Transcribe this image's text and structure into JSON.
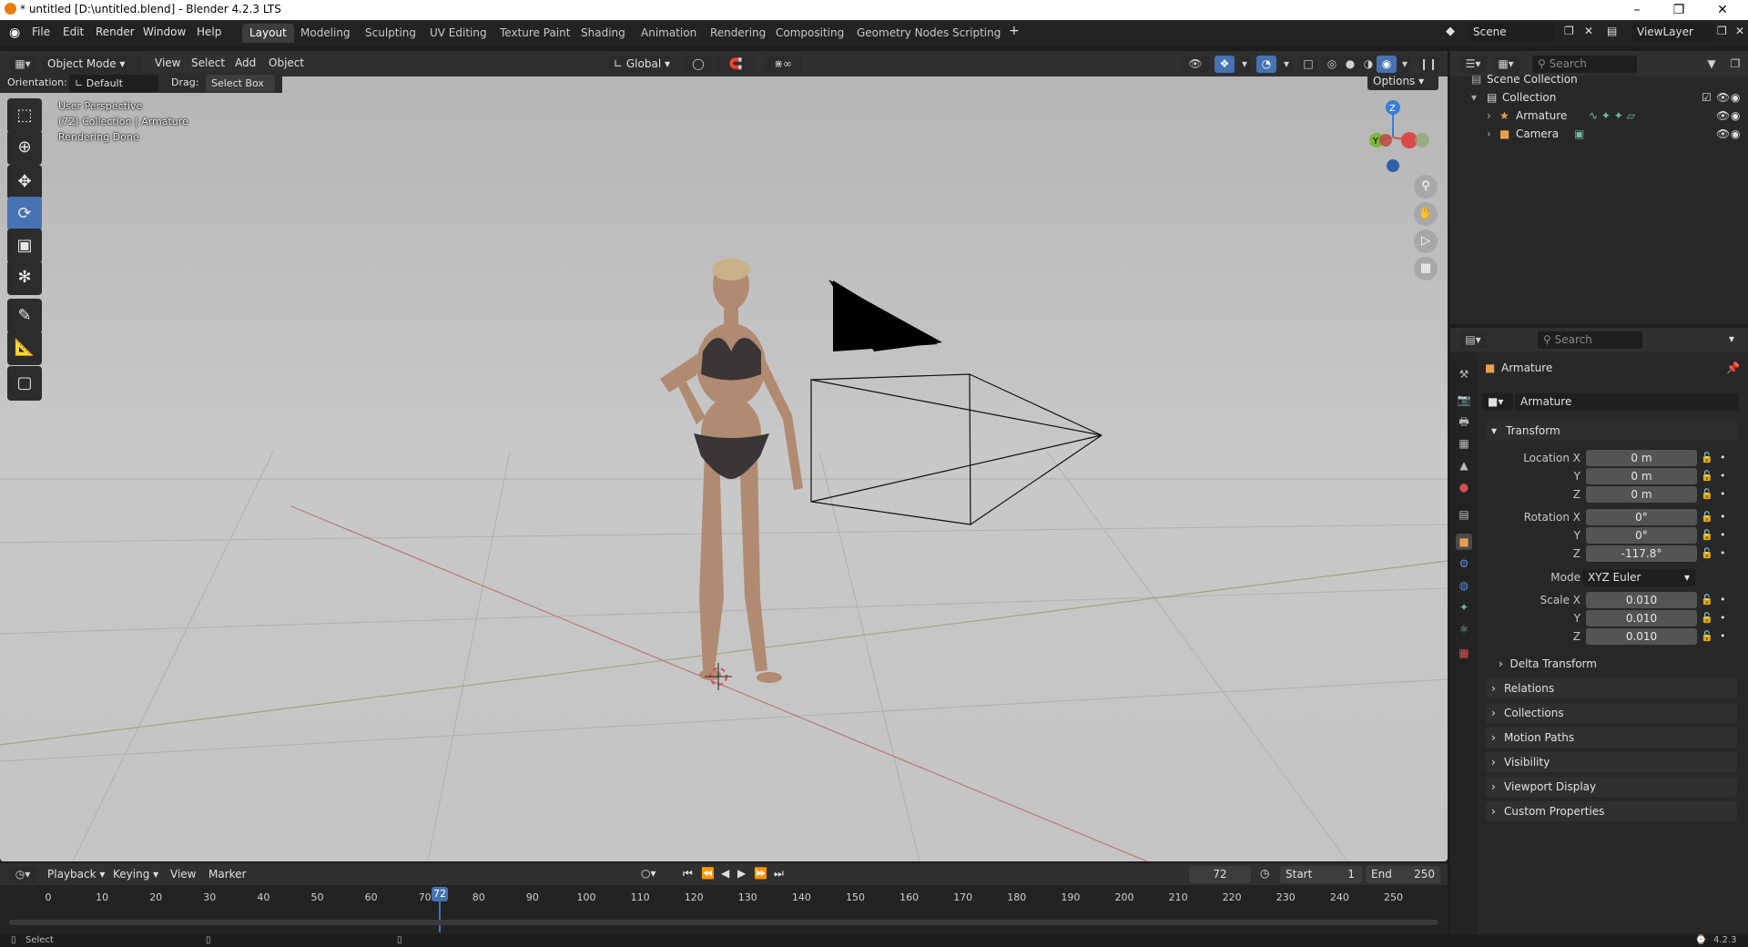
{
  "window": {
    "title": "* untitled [D:\\untitled.blend] - Blender 4.2.3 LTS",
    "min_icon": "minimize-icon",
    "max_icon": "restore-icon",
    "close_icon": "close-icon"
  },
  "menu": [
    "File",
    "Edit",
    "Render",
    "Window",
    "Help"
  ],
  "workspaces": [
    "Layout",
    "Modeling",
    "Sculpting",
    "UV Editing",
    "Texture Paint",
    "Shading",
    "Animation",
    "Rendering",
    "Compositing",
    "Geometry Nodes",
    "Scripting"
  ],
  "active_workspace": "Layout",
  "scene": {
    "label": "Scene",
    "view_layer": "ViewLayer"
  },
  "viewport_header": {
    "mode": "Object Mode",
    "menus": [
      "View",
      "Select",
      "Add",
      "Object"
    ],
    "transform_orientation": "Global",
    "options": "Options"
  },
  "tool_header": {
    "orientation_label": "Orientation:",
    "orientation_value": "Default",
    "drag_label": "Drag:",
    "drag_value": "Select Box"
  },
  "overlay_text": {
    "line1": "User Perspective",
    "line2": "(72) Collection | Armature",
    "line3": "Rendering Done"
  },
  "gizmo": {
    "z": "Z",
    "y": "Y",
    "x": "X"
  },
  "outliner": {
    "search_placeholder": "Search",
    "root": "Scene Collection",
    "collection": "Collection",
    "items": [
      "Armature",
      "Camera"
    ]
  },
  "properties": {
    "search_placeholder": "Search",
    "object_name": "Armature",
    "data_name": "Armature",
    "transform_title": "Transform",
    "location_label": "Location X",
    "location": [
      "0 m",
      "0 m",
      "0 m"
    ],
    "rotation_label": "Rotation X",
    "rotation": [
      "0°",
      "0°",
      "-117.8°"
    ],
    "mode_label": "Mode",
    "mode_value": "XYZ Euler",
    "scale_label": "Scale X",
    "scale": [
      "0.010",
      "0.010",
      "0.010"
    ],
    "axis_y": "Y",
    "axis_z": "Z",
    "delta": "Delta Transform",
    "panels": [
      "Relations",
      "Collections",
      "Motion Paths",
      "Visibility",
      "Viewport Display",
      "Custom Properties"
    ]
  },
  "timeline": {
    "menus": [
      "Playback",
      "Keying",
      "View",
      "Marker"
    ],
    "current_frame": "72",
    "start_label": "Start",
    "start": "1",
    "end_label": "End",
    "end": "250",
    "ticks": [
      "0",
      "10",
      "20",
      "30",
      "40",
      "50",
      "60",
      "70",
      "80",
      "90",
      "100",
      "110",
      "120",
      "130",
      "140",
      "150",
      "160",
      "170",
      "180",
      "190",
      "200",
      "210",
      "220",
      "230",
      "240",
      "250"
    ]
  },
  "status": {
    "left": "Select",
    "version": "4.2.3"
  }
}
